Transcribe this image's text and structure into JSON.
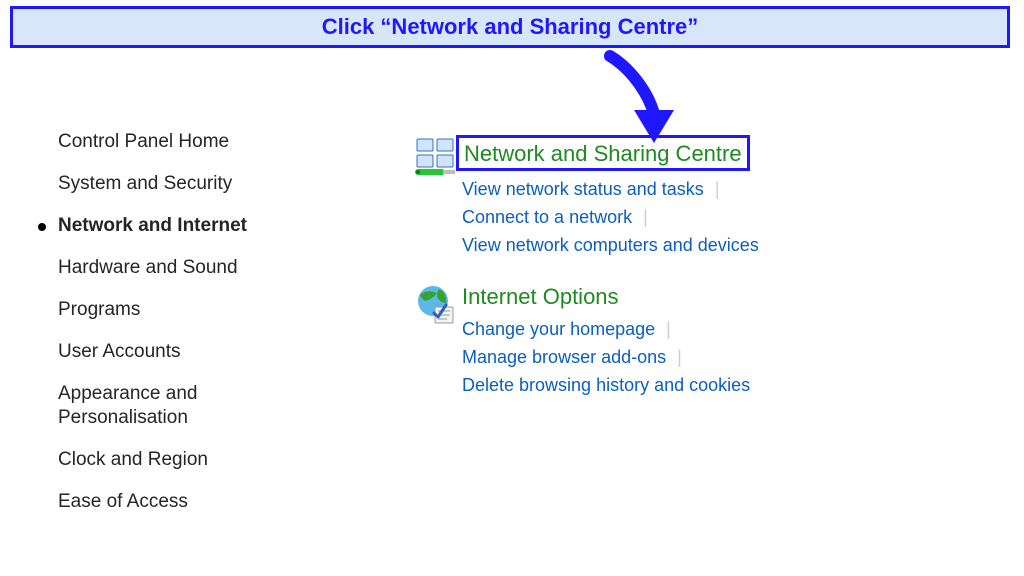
{
  "banner": {
    "text": "Click “Network and Sharing Centre”"
  },
  "sidebar": {
    "items": [
      {
        "label": "Control Panel Home"
      },
      {
        "label": "System and Security"
      },
      {
        "label": "Network and Internet",
        "active": true
      },
      {
        "label": "Hardware and Sound"
      },
      {
        "label": "Programs"
      },
      {
        "label": "User Accounts"
      },
      {
        "label": "Appearance and Personalisation"
      },
      {
        "label": "Clock and Region"
      },
      {
        "label": "Ease of Access"
      }
    ]
  },
  "groups": {
    "network": {
      "title": "Network and Sharing Centre",
      "links": [
        "View network status and tasks",
        "Connect to a network",
        "View network computers and devices"
      ]
    },
    "internet": {
      "title": "Internet Options",
      "links": [
        "Change your homepage",
        "Manage browser add-ons",
        "Delete browsing history and cookies"
      ]
    }
  },
  "colors": {
    "banner_bg": "#d7e6fb",
    "accent_blue": "#1f17ff",
    "link_blue": "#0b5fbf",
    "section_green": "#1f8a1f"
  }
}
